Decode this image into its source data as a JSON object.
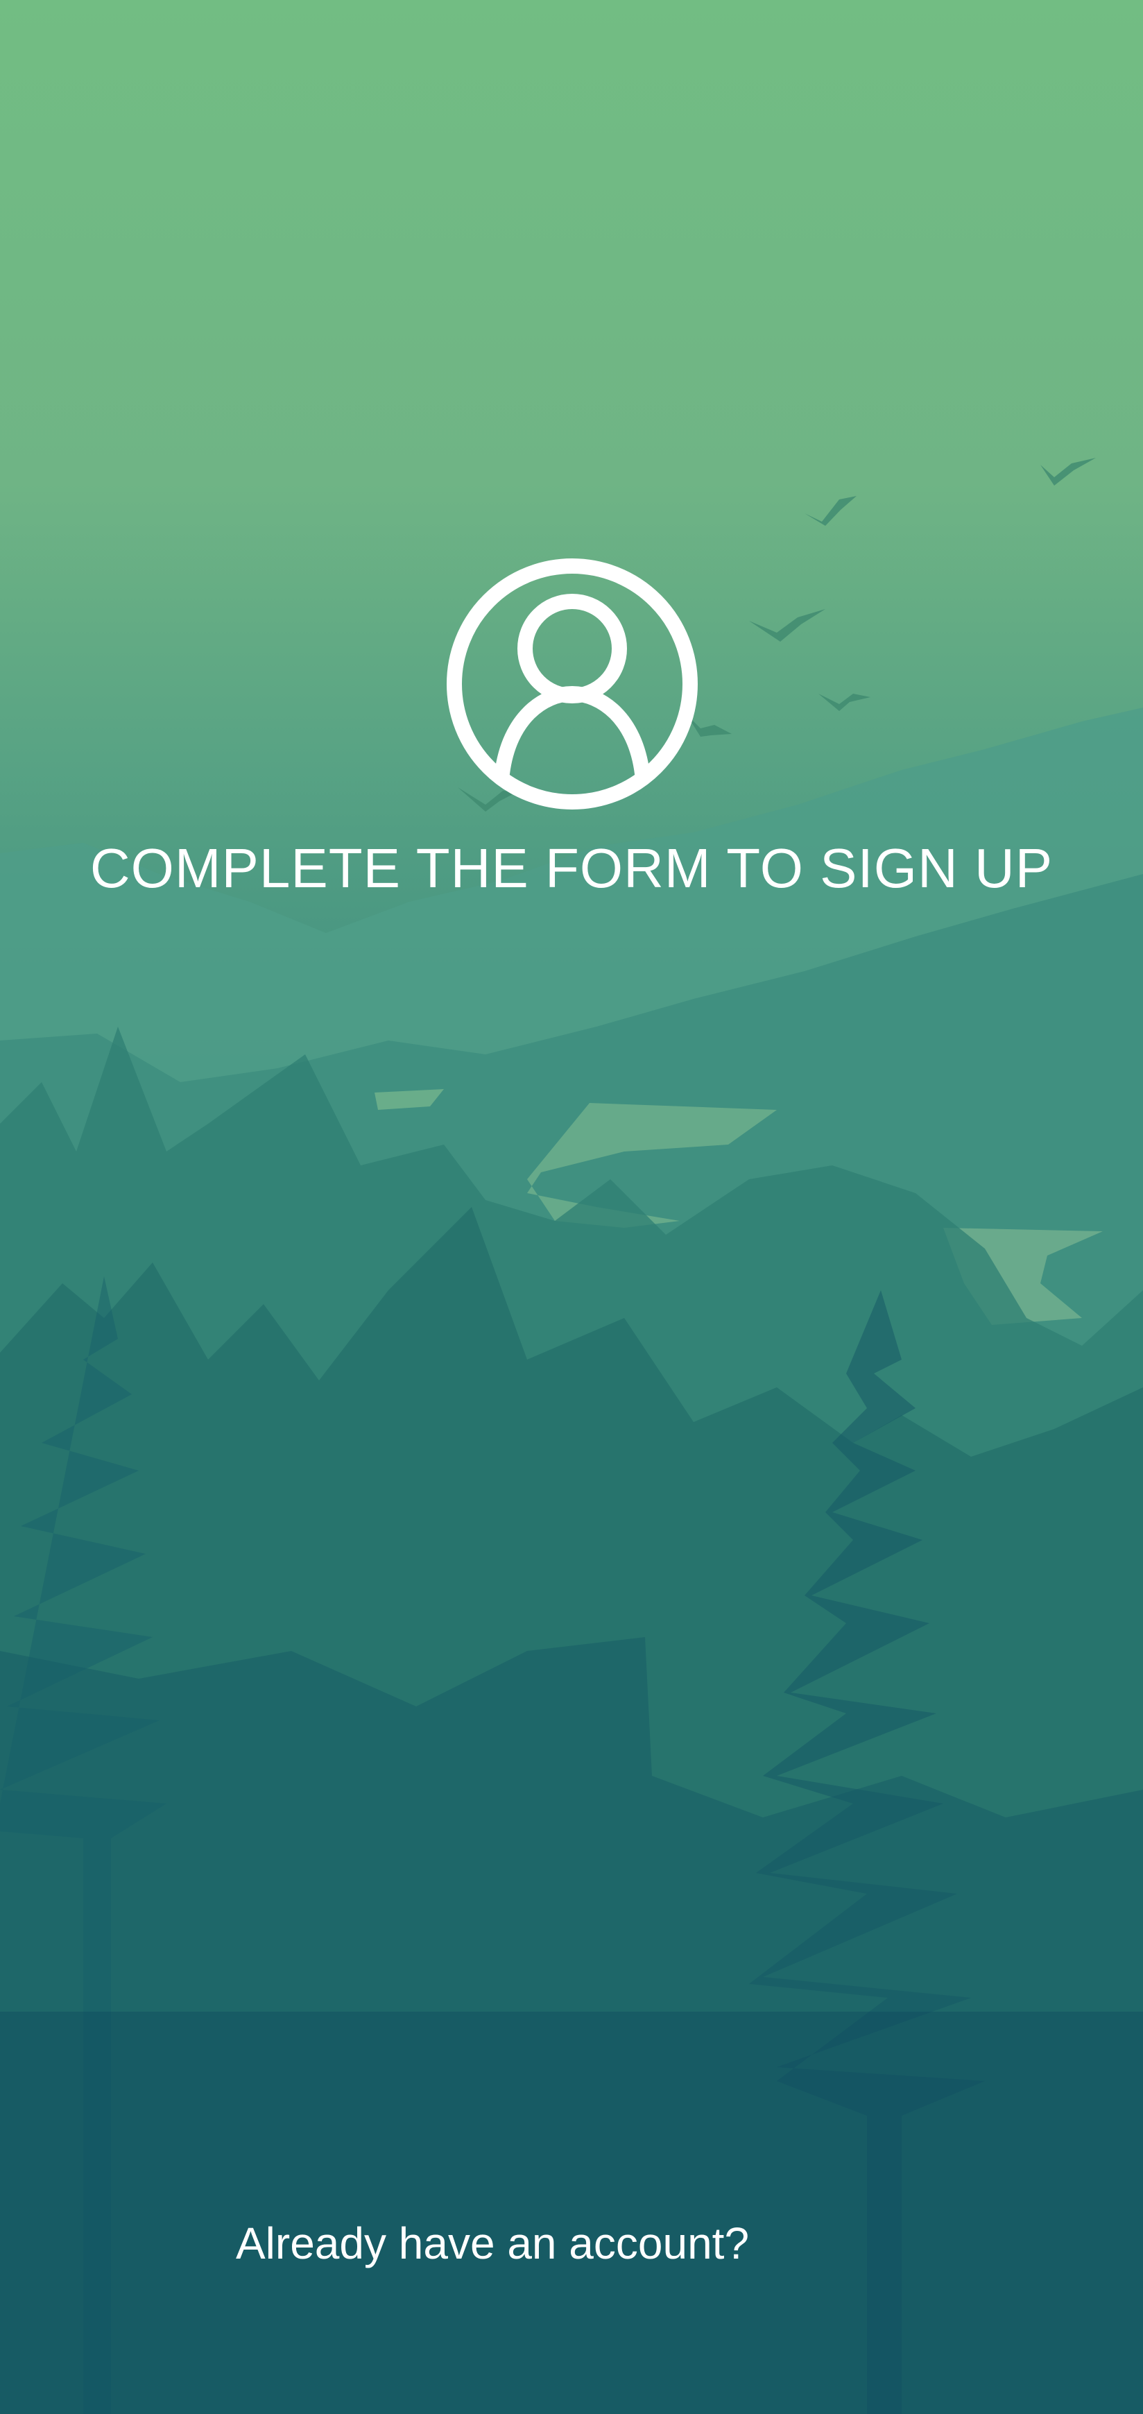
{
  "signup": {
    "title": "COMPLETE THE FORM TO SIGN UP",
    "login_link": "Already have an account?"
  },
  "icons": {
    "avatar": "user-circle-icon"
  },
  "colors": {
    "text": "#ffffff",
    "top_green": "#72bd83",
    "bottom_teal": "#0b465d"
  }
}
